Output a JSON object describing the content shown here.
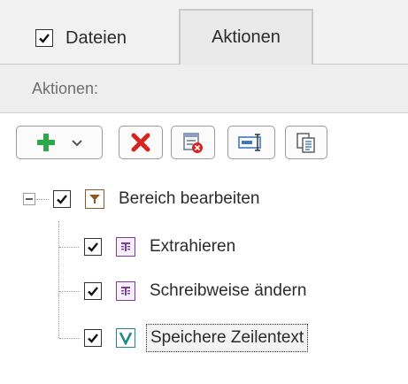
{
  "tabs": [
    {
      "label": "Dateien",
      "checked": true,
      "active": false
    },
    {
      "label": "Aktionen",
      "active": true
    }
  ],
  "section": {
    "label": "Aktionen:"
  },
  "toolbar": {
    "add_icon": "add-plus-icon",
    "dropdown_icon": "chevron-down-icon",
    "delete_icon": "delete-x-icon",
    "delete_all_icon": "delete-all-icon",
    "rename_icon": "rename-field-icon",
    "copy_icon": "copy-icon"
  },
  "tree": {
    "root": {
      "label": "Bereich bearbeiten",
      "checked": true,
      "icon": "filter-icon",
      "expanded": true
    },
    "children": [
      {
        "label": "Extrahieren",
        "checked": true,
        "icon": "text-extract-icon"
      },
      {
        "label": "Schreibweise ändern",
        "checked": true,
        "icon": "text-case-icon"
      },
      {
        "label": "Speichere Zeilentext",
        "checked": true,
        "icon": "v-save-icon",
        "selected": true
      }
    ]
  },
  "colors": {
    "add_green": "#2aa84a",
    "delete_red": "#d6241f",
    "filter_brown": "#8b5a2b",
    "text_icon_purple": "#7a3c9c",
    "v_icon_teal": "#1f8a8a"
  }
}
